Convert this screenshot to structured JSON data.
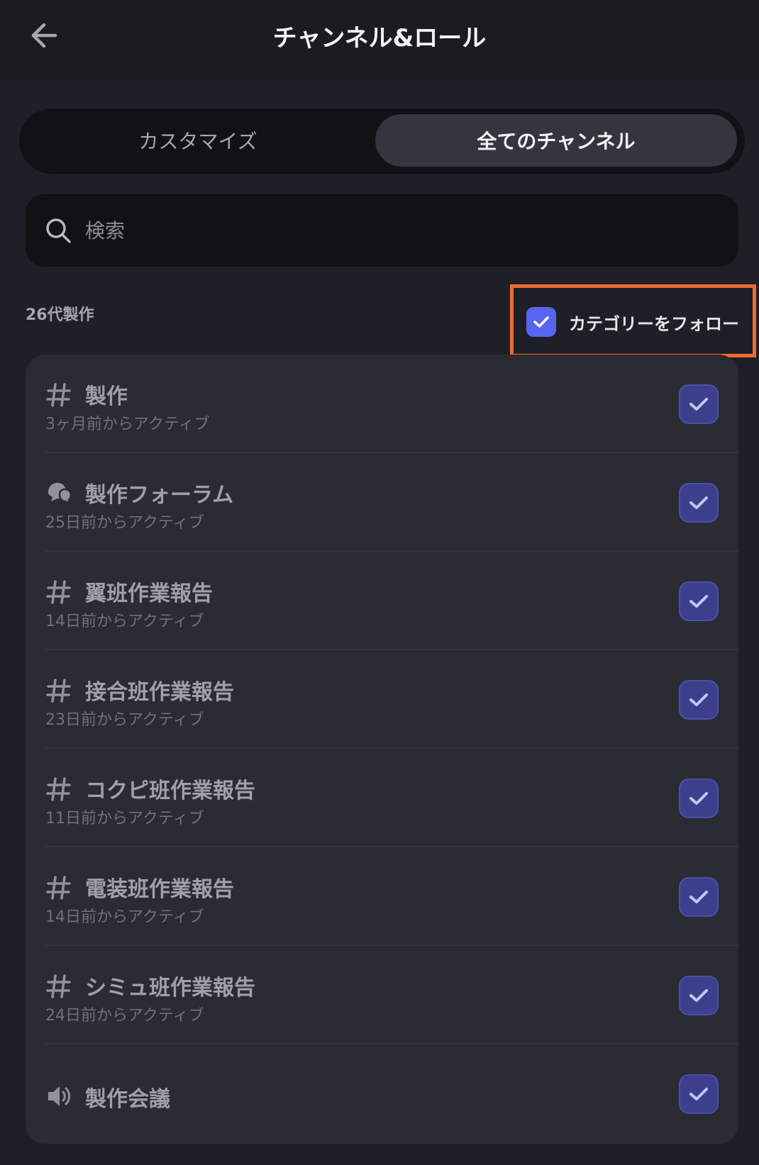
{
  "header": {
    "title": "チャンネル&ロール"
  },
  "tabs": [
    {
      "label": "カスタマイズ",
      "active": false
    },
    {
      "label": "全てのチャンネル",
      "active": true
    }
  ],
  "search": {
    "placeholder": "検索",
    "value": ""
  },
  "category": {
    "name": "26代製作",
    "follow_label": "カテゴリーをフォロー",
    "follow_checked": true
  },
  "channels": [
    {
      "icon": "hash-icon",
      "name": "製作",
      "activity": "3ヶ月前からアクティブ",
      "checked": true
    },
    {
      "icon": "forum-icon",
      "name": "製作フォーラム",
      "activity": "25日前からアクティブ",
      "checked": true
    },
    {
      "icon": "hash-icon",
      "name": "翼班作業報告",
      "activity": "14日前からアクティブ",
      "checked": true
    },
    {
      "icon": "hash-icon",
      "name": "接合班作業報告",
      "activity": "23日前からアクティブ",
      "checked": true
    },
    {
      "icon": "hash-icon",
      "name": "コクピ班作業報告",
      "activity": "11日前からアクティブ",
      "checked": true
    },
    {
      "icon": "hash-icon",
      "name": "電装班作業報告",
      "activity": "14日前からアクティブ",
      "checked": true
    },
    {
      "icon": "hash-icon",
      "name": "シミュ班作業報告",
      "activity": "24日前からアクティブ",
      "checked": true
    },
    {
      "icon": "speaker-icon",
      "name": "製作会議",
      "activity": "",
      "checked": true
    }
  ],
  "colors": {
    "background": "#1f2027",
    "accent": "#5865f2",
    "highlight": "#f26a33"
  }
}
